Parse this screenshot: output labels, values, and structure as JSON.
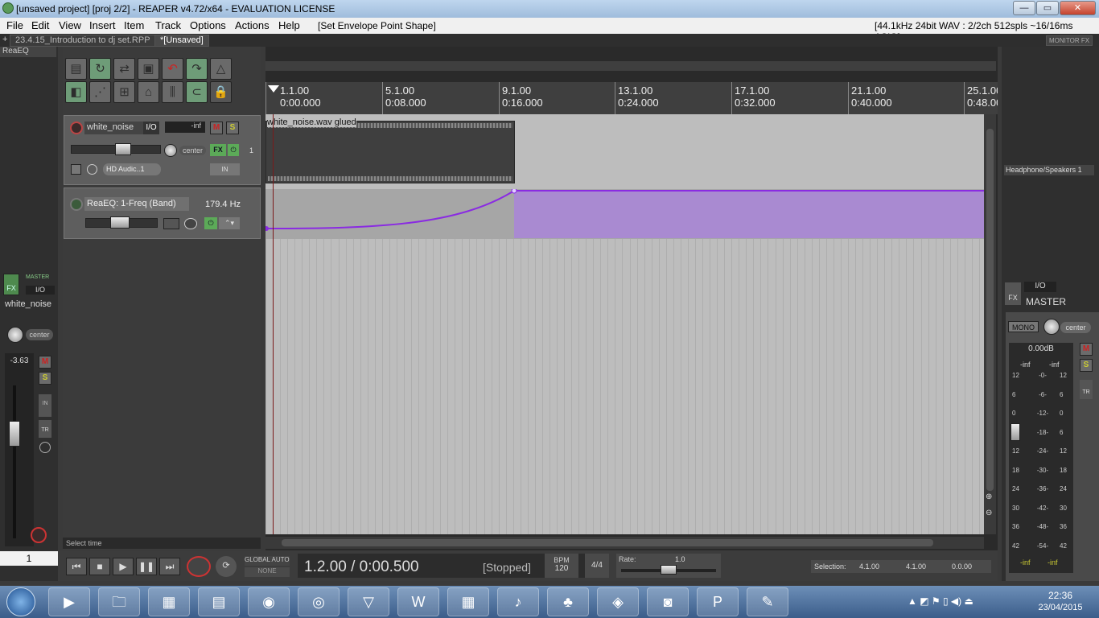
{
  "window": {
    "title": "[unsaved project] [proj 2/2] - REAPER v4.72/x64 - EVALUATION LICENSE",
    "min": "—",
    "max": "▭",
    "close": "✕"
  },
  "menu": {
    "items": [
      "File",
      "Edit",
      "View",
      "Insert",
      "Item",
      "Track",
      "Options",
      "Actions",
      "Help"
    ],
    "action_label": "[Set Envelope Point Shape]",
    "audio_status": "[44.1kHz 24bit WAV : 2/2ch 512spls ~16/16ms ASIO]"
  },
  "tabs": {
    "plus": "+",
    "tab1": "23.4.15_Introduction to dj set.RPP",
    "tab2": "*[Unsaved]",
    "monitor": "MONITOR FX"
  },
  "leftmixer": {
    "header": "ReaEQ",
    "fx_label": "FX",
    "master_label": "MASTER",
    "io_label": "I/O",
    "track_name": "white_noise",
    "pan": "center",
    "volume": "-3.63",
    "m": "M",
    "s": "S",
    "in": "IN",
    "tr": "TR",
    "track_number": "1"
  },
  "tcp": {
    "track_name": "white_noise",
    "io": "I/O",
    "vol_db": "-inf",
    "m": "M",
    "s": "S",
    "pan": "center",
    "fx": "FX",
    "input": "HD Audic..1",
    "in": "IN",
    "track_number": "1",
    "env_name": "ReaEQ: 1-Freq (Band)",
    "env_value": "179.4 Hz",
    "status": "Select time"
  },
  "ruler": {
    "marks": [
      {
        "bar": "1.1.00",
        "time": "0:00.000"
      },
      {
        "bar": "5.1.00",
        "time": "0:08.000"
      },
      {
        "bar": "9.1.00",
        "time": "0:16.000"
      },
      {
        "bar": "13.1.00",
        "time": "0:24.000"
      },
      {
        "bar": "17.1.00",
        "time": "0:32.000"
      },
      {
        "bar": "21.1.00",
        "time": "0:40.000"
      },
      {
        "bar": "25.1.00",
        "time": "0:48.000"
      }
    ]
  },
  "item": {
    "name": "white_noise.wav glued"
  },
  "rightmixer": {
    "hardware_out": "Headphone/Speakers 1",
    "io": "I/O",
    "fx": "FX",
    "master": "MASTER",
    "mono": "MONO",
    "pan": "center",
    "peak": "0.00dB",
    "inf_l": "-inf",
    "inf_r": "-inf",
    "m": "M",
    "s": "S",
    "tr": "TR",
    "scale": [
      "-0-",
      "-6-",
      "-12-",
      "-18-",
      "-24-",
      "-30-",
      "-36-",
      "-42-",
      "-48-",
      "-54-"
    ],
    "left_scale": [
      "12",
      "6",
      "0",
      "6",
      "12",
      "18",
      "24",
      "30",
      "36",
      "42"
    ],
    "bottom_l": "-inf",
    "bottom_r": "-inf"
  },
  "transport": {
    "global_auto": "GLOBAL AUTO",
    "none": "NONE",
    "position": "1.2.00 / 0:00.500",
    "state": "[Stopped]",
    "bpm_label": "BPM",
    "bpm": "120",
    "timesig": "4/4",
    "rate_label": "Rate:",
    "rate": "1.0",
    "selection_label": "Selection:",
    "sel_start": "4.1.00",
    "sel_end": "4.1.00",
    "sel_len": "0.0.00"
  },
  "taskbar": {
    "time": "22:36",
    "date": "23/04/2015",
    "icons": [
      "media-player",
      "file-explorer",
      "calculator",
      "task-manager",
      "chrome",
      "audio-app",
      "reaper",
      "word",
      "grid-app",
      "music-app",
      "tree-app",
      "unity",
      "speaker-app",
      "powerpoint",
      "paint"
    ]
  }
}
